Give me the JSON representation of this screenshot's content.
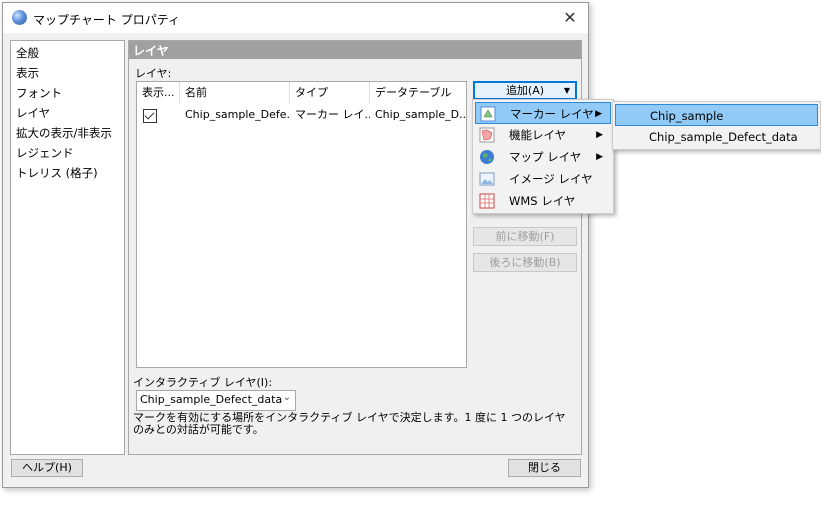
{
  "window": {
    "title": "マップチャート プロパティ",
    "close_glyph": "✕"
  },
  "nav": {
    "items": [
      "全般",
      "表示",
      "フォント",
      "レイヤ",
      "拡大の表示/非表示",
      "レジェンド",
      "トレリス (格子)"
    ]
  },
  "section": {
    "title": "レイヤ",
    "layers_label": "レイヤ:"
  },
  "table": {
    "columns": [
      "表示...",
      "名前",
      "タイプ",
      "データテーブル"
    ],
    "rows": [
      {
        "visible": true,
        "name": "Chip_sample_Defe...",
        "type": "マーカー レイ...",
        "data_table": "Chip_sample_D..."
      }
    ]
  },
  "buttons": {
    "add": "追加(A)",
    "move_up": "前に移動(F)",
    "move_down": "後ろに移動(B)",
    "help": "ヘルプ(H)",
    "close": "閉じる"
  },
  "interactive": {
    "label": "インタラクティブ レイヤ(I):",
    "value": "Chip_sample_Defect_data",
    "description": "マークを有効にする場所をインタラクティブ レイヤで決定します。1 度に 1 つのレイヤのみとの対話が可能です。"
  },
  "add_menu": {
    "items": [
      {
        "label": "マーカー レイヤ",
        "icon": "marker-layer-icon",
        "submenu": true,
        "highlighted": true
      },
      {
        "label": "機能レイヤ",
        "icon": "feature-layer-icon",
        "submenu": true,
        "highlighted": false
      },
      {
        "label": "マップ レイヤ",
        "icon": "globe-icon",
        "submenu": true,
        "highlighted": false
      },
      {
        "label": "イメージ レイヤ",
        "icon": "image-layer-icon",
        "submenu": false,
        "highlighted": false
      },
      {
        "label": "WMS レイヤ",
        "icon": "wms-layer-icon",
        "submenu": false,
        "highlighted": false
      }
    ],
    "arrow_glyph": "▶"
  },
  "submenu": {
    "items": [
      {
        "label": "Chip_sample",
        "highlighted": true
      },
      {
        "label": "Chip_sample_Defect_data",
        "highlighted": false
      }
    ]
  },
  "colors": {
    "highlight": "#91c9f7",
    "section_header": "#a0a0a0",
    "focus_border": "#0078d7"
  }
}
